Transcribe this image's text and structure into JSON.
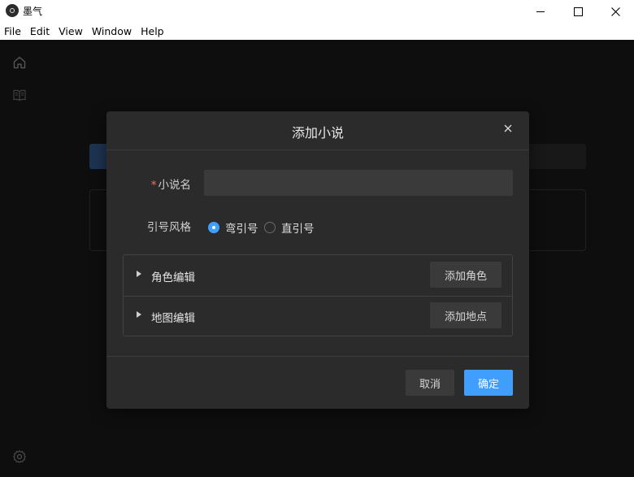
{
  "window": {
    "title": "墨气"
  },
  "menu": [
    "File",
    "Edit",
    "View",
    "Window",
    "Help"
  ],
  "sidebar": {
    "icons": [
      "home-icon",
      "book-icon",
      "gear-icon"
    ]
  },
  "dialog": {
    "title": "添加小说",
    "name_label": "小说名",
    "name_value": "",
    "quote_label": "引号风格",
    "quote_options": [
      {
        "label": "弯引号",
        "selected": true
      },
      {
        "label": "直引号",
        "selected": false
      }
    ],
    "sections": [
      {
        "title": "角色编辑",
        "button": "添加角色"
      },
      {
        "title": "地图编辑",
        "button": "添加地点"
      }
    ],
    "cancel_label": "取消",
    "ok_label": "确定"
  },
  "colors": {
    "accent": "#409eff",
    "required": "#f56c6c",
    "dialog_bg": "#2b2b2b",
    "app_bg": "#161616"
  }
}
